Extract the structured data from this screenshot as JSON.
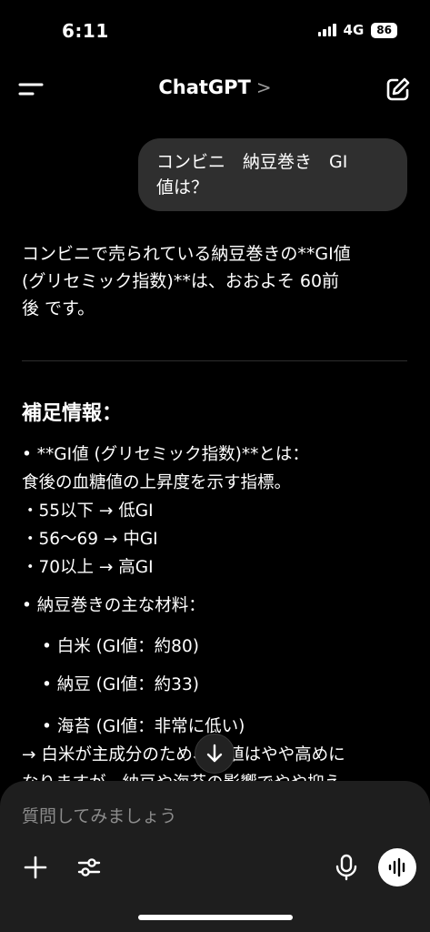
{
  "status_bar": {
    "time": "6:11",
    "network": "4G",
    "battery": "86"
  },
  "header": {
    "title": "ChatGPT",
    "chevron": ">"
  },
  "user_message": {
    "line1": "コンビニ　納豆巻き　GI",
    "line2": "値は？"
  },
  "assistant": {
    "answer_lines": [
      "コンビニで売られている納豆巻きの**GI値",
      "(グリセミック指数)**は、おおよそ 60前",
      "後 です。"
    ],
    "section_title": "補足情報：",
    "gi_lines": [
      "• **GI値 (グリセミック指数)**とは：",
      "食後の血糖値の上昇度を示す指標。",
      "・55以下 → 低GI",
      "・56〜69 → 中GI",
      "・70以上 → 高GI"
    ],
    "materials_title": "• 納豆巻きの主な材料：",
    "materials": [
      "•  白米 (GI値：約80)",
      "•  納豆 (GI値：約33)",
      "•  海苔 (GI値：非常に低い)"
    ],
    "conclusion_lines": [
      "→ 白米が主成分のため、GI値はやや高めに",
      "なりますが、納豆や海苔の影響でやや抑え"
    ]
  },
  "composer": {
    "placeholder": "質問してみましょう"
  },
  "icons": {
    "menu": "menu-icon",
    "compose": "compose-icon",
    "scroll_down": "arrow-down-icon",
    "plus": "plus-icon",
    "tools": "sliders-icon",
    "mic": "mic-icon",
    "voice": "waveform-icon"
  },
  "colors": {
    "background": "#000000",
    "bubble": "#2f2f2f",
    "composer": "#1e1e1e",
    "placeholder": "#8c8c8c"
  }
}
